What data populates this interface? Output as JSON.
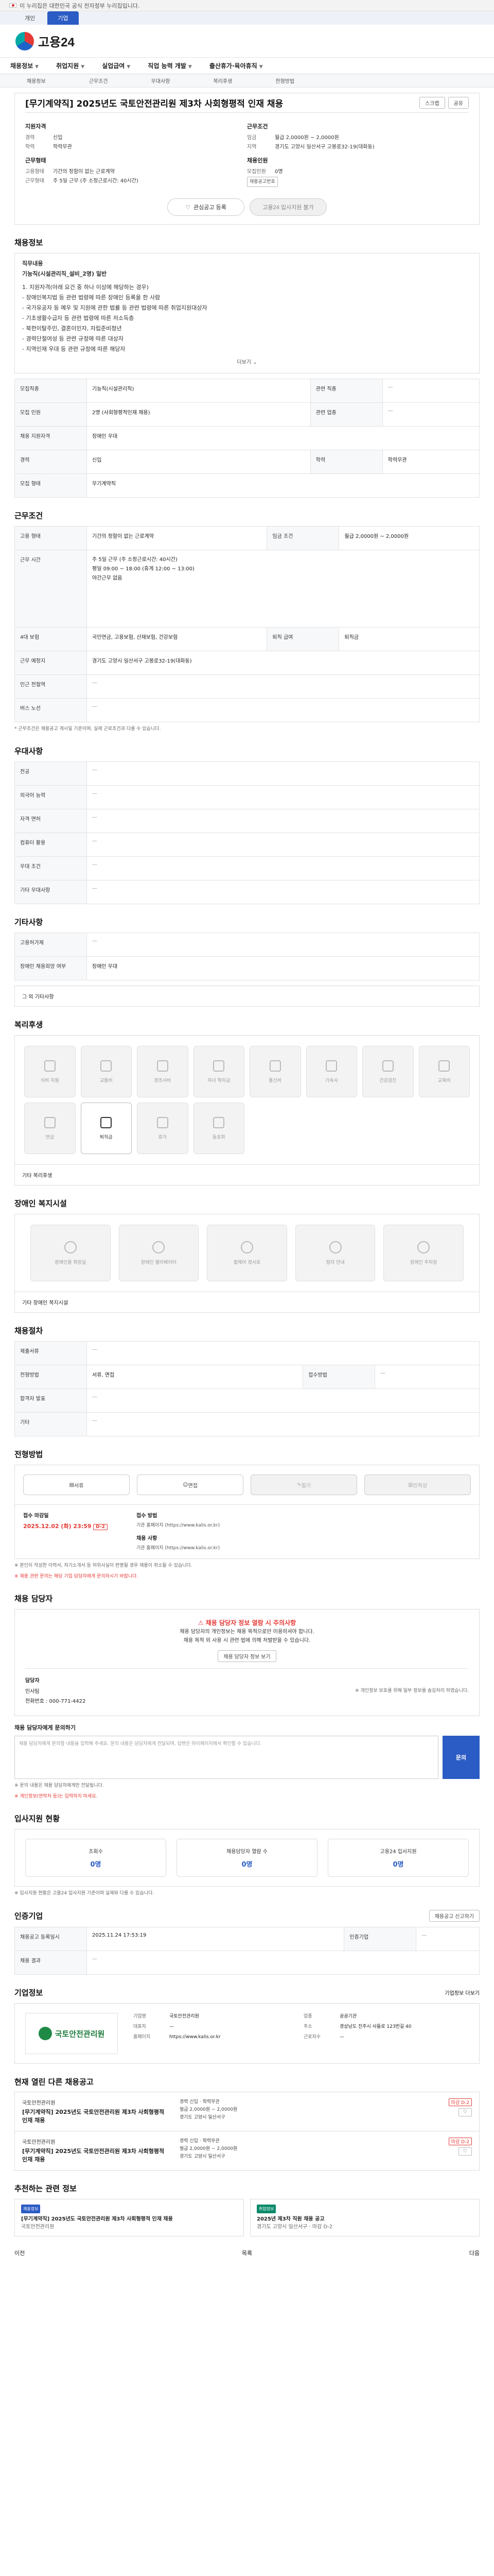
{
  "gov_banner": "이 누리집은 대한민국 공식 전자정부 누리집입니다.",
  "top_tabs": [
    "개인",
    "기업"
  ],
  "logo": "고용24",
  "gnb": [
    "채용정보",
    "취업지원",
    "실업급여",
    "직업 능력 개발",
    "출산휴가·육아휴직"
  ],
  "snb": [
    "채용정보",
    "근무조건",
    "우대사항",
    "복리후생",
    "전형방법"
  ],
  "title": {
    "prefix": "[무기계약직]",
    "text": "[무기계약직] 2025년도 국토안전관리원 제3차 사회형평적 인재 채용",
    "scrap": "스크랩",
    "share": "공유"
  },
  "summary": {
    "col1": {
      "head": "지원자격",
      "rows": [
        {
          "k": "경력",
          "v": "신입"
        },
        {
          "k": "학력",
          "v": "학력무관"
        }
      ],
      "head2": "근무형태",
      "rows2": [
        {
          "k": "고용형태",
          "v": "기간의 정함이 없는 근로계약"
        },
        {
          "k": "근무형태",
          "v": "주 5일 근무 (주 소정근로시간: 40시간)"
        }
      ]
    },
    "col2": {
      "head": "근무조건",
      "rows": [
        {
          "k": "임금",
          "v": "월급 2,0000원 ~ 2,0000원"
        },
        {
          "k": "지역",
          "v": "경기도 고양시 일산서구 고봉로32-19(대화동)"
        }
      ],
      "head2": "채용인원",
      "rows2": [
        {
          "k": "모집인원",
          "v": "0명"
        }
      ],
      "tag": "채용공고번호"
    }
  },
  "actions": [
    "관심공고 등록",
    "고용24 입사지원 불가"
  ],
  "sections": {
    "recruit_info": "채용정보",
    "work_cond": "근무조건",
    "prefer": "우대사항",
    "etc_info": "기타사항",
    "welfare": "복리후생",
    "disabled": "장애인 복지시설",
    "hire_process": "채용절차",
    "process": "전형방법",
    "manager": "채용 담당자",
    "stats": "입사지원 현황",
    "institution": "인증기업",
    "company": "기업정보",
    "same_company": "현재 열린 다른 채용공고",
    "related": "추천하는 관련 정보"
  },
  "job_desc": {
    "label": "직무내용",
    "big": "기능직(시설관리직_설비_2명) 일반",
    "lines": [
      "1. 지원자격(아래 요건 중 하나 이상에 해당하는 경우)",
      " - 장애인복지법 등 관련 법령에 따른 장애인 등록을 한 사람",
      " - 국가유공자 등 예우 및 지원에 관한 법률 등 관련 법령에 따른 취업지원대상자",
      " - 기초생활수급자 등 관련 법령에 따른 저소득층",
      " - 북한이탈주민, 결혼이민자, 자립준비청년",
      " - 경력단절여성 등 관련 규정에 따른 대상자",
      " - 지역인재 우대 등 관련 규정에 따른 해당자"
    ],
    "more": "더보기"
  },
  "recruit_table": [
    {
      "k": "모집직종",
      "v": "기능직(시설관리직)",
      "k2": "관련 직종",
      "v2": "—"
    },
    {
      "k": "모집 인원",
      "v": "2명 (사회형평적인재 채용)",
      "k2": "관련 업종",
      "v2": "—"
    },
    {
      "k": "채용 지원자격",
      "v": "장애인 우대",
      "k2": "",
      "v2": ""
    },
    {
      "k": "경력",
      "v": "신입",
      "k2": "학력",
      "v2": "학력무관"
    },
    {
      "k": "모집 형태",
      "v": "무기계약직",
      "k2": "",
      "v2": ""
    }
  ],
  "work_table": [
    {
      "k": "고용 형태",
      "v": "기간의 정함이 없는 근로계약",
      "k2": "임금 조건",
      "v2": "월급 2,0000원 ~ 2,0000원"
    },
    {
      "k": "근무 시간",
      "v": "주 5일 근무 (주 소정근로시간: 40시간)\n평일 09:00 ~ 18:00 (휴게 12:00 ~ 13:00)\n야간근무 없음",
      "k2": "",
      "v2": ""
    },
    {
      "k": "4대 보험",
      "v": "국민연금, 고용보험, 산재보험, 건강보험",
      "k2": "퇴직 급여",
      "v2": "퇴직금"
    },
    {
      "k": "근무 예정지",
      "v": "경기도 고양시 일산서구 고봉로32-19(대화동)",
      "k2": "",
      "v2": ""
    },
    {
      "k": "인근 전철역",
      "v": "—",
      "k2": "",
      "v2": ""
    },
    {
      "k": "버스 노선",
      "v": "—",
      "k2": "",
      "v2": ""
    }
  ],
  "work_note": "* 근무조건은 채용공고 게시일 기준이며, 실제 근로조건과 다를 수 있습니다.",
  "prefer_table": [
    {
      "k": "전공",
      "v": "—"
    },
    {
      "k": "외국어 능력",
      "v": "—"
    },
    {
      "k": "자격 면허",
      "v": "—"
    },
    {
      "k": "컴퓨터 활용",
      "v": "—"
    },
    {
      "k": "우대 조건",
      "v": "—"
    },
    {
      "k": "기타 우대사항",
      "v": "—"
    }
  ],
  "etc_table": [
    {
      "k": "고용허가제",
      "v": "—"
    },
    {
      "k": "장애인 채용희망 여부",
      "v": "장애인 우대"
    }
  ],
  "etc_note": "그 외 기타사항",
  "welfare_items": [
    "식비 지원",
    "교통비",
    "경조사비",
    "자녀 학자금",
    "통신비",
    "기숙사",
    "건강검진",
    "교육비",
    "연금",
    "퇴직금",
    "휴가",
    "동호회"
  ],
  "welfare_sub": "기타 복리후생",
  "disabled_items": [
    "장애인용 화장실",
    "장애인 엘리베이터",
    "휠체어 경사로",
    "점자 안내",
    "장애인 주차장"
  ],
  "disabled_sub": "기타 장애인 복지시설",
  "process_table": [
    {
      "k": "제출서류",
      "v": "—"
    },
    {
      "k": "전형방법",
      "v": "서류, 면접",
      "k2": "접수방법",
      "v2": "—"
    },
    {
      "k": "합격자 발표",
      "v": "—",
      "k2": "",
      "v2": ""
    },
    {
      "k": "기타",
      "v": "—",
      "k2": "",
      "v2": ""
    }
  ],
  "process_buttons": [
    "서류",
    "면접",
    "필기",
    "인적성"
  ],
  "deadline": {
    "label": "접수 마감일",
    "date": "2025.12.02 (화) 23:59",
    "remain": "D-2",
    "label2": "접수 방법",
    "method": "기관 홈페이지 (https://www.kalis.or.kr)",
    "contact_label": "채용 사항",
    "contact": "기관 홈페이지 (https://www.kalis.or.kr)"
  },
  "hire_notes": [
    "※ 본인이 작성한 이력서, 자기소개서 등 허위사실이 판명될 경우 채용이 취소될 수 있습니다.",
    "※ 채용 관련 문의는 해당 기업 담당자에게 문의하시기 바랍니다."
  ],
  "manager": {
    "notice_title": "채용 담당자 정보 열람 시 주의사항",
    "notice_lines": [
      "채용 담당자의 개인정보는 채용 목적으로만 이용하셔야 합니다.",
      "채용 목적 외 사용 시 관련 법에 의해 처벌받을 수 있습니다."
    ],
    "view_btn": "채용 담당자 정보 보기",
    "name_label": "담당자",
    "name": "인사팀",
    "phone": "전화번호 : 000-771-4422",
    "mask_note": "※ 개인정보 보호를 위해 일부 정보를 숨김처리 하였습니다.",
    "ask_label": "채용 담당자에게 문의하기",
    "ask_placeholder": "채용 담당자에게 문의할 내용을 입력해 주세요. 문의 내용은 담당자에게 전달되며, 답변은 마이페이지에서 확인할 수 있습니다.",
    "ask_btn": "문의",
    "ask_notes": [
      "※ 문의 내용은 채용 담당자에게만 전달됩니다.",
      "※ 개인정보(연락처 등)는 입력하지 마세요."
    ]
  },
  "stats": [
    {
      "t": "조회수",
      "n": "0명"
    },
    {
      "t": "채용담당자 열람 수",
      "n": "0명"
    },
    {
      "t": "고용24 입사지원",
      "n": "0명"
    }
  ],
  "stats_note": "※ 입사지원 현황은 고용24 입사지원 기준이며 실제와 다를 수 있습니다.",
  "cert_table": [
    {
      "k": "채용공고 등록일시",
      "v": "2025.11.24 17:53:19",
      "k2": "인증기업",
      "v2": "—"
    },
    {
      "k": "채용 결과",
      "v": "—",
      "k2": "",
      "v2": ""
    }
  ],
  "cert_btn": "채용공고 신고하기",
  "company": {
    "name": "국토안전관리원",
    "info": [
      {
        "k": "기업명",
        "v": "국토안전관리원"
      },
      {
        "k": "업종",
        "v": "공공기관"
      },
      {
        "k": "대표자",
        "v": "—"
      },
      {
        "k": "주소",
        "v": "경상남도 진주시 사들로 123번길 40"
      },
      {
        "k": "홈페이지",
        "v": "https://www.kalis.or.kr"
      },
      {
        "k": "근로자수",
        "v": "—"
      }
    ],
    "link": "기업정보 더보기"
  },
  "other_jobs": [
    {
      "comp": "국토안전관리원",
      "title": "[무기계약직] 2025년도 국토안전관리원 제3차 사회형평적 인재 채용",
      "info": "경력 신입 · 학력무관\n월급 2,0000원 ~ 2,0000원\n경기도 고양시 일산서구",
      "deadline": "마감 D-2"
    },
    {
      "comp": "국토안전관리원",
      "title": "[무기계약직] 2025년도 국토안전관리원 제3차 사회형평적 인재 채용",
      "info": "경력 신입 · 학력무관\n월급 2,0000원 ~ 2,0000원\n경기도 고양시 일산서구",
      "deadline": "마감 D-2"
    }
  ],
  "related": [
    {
      "badge": "채용정보",
      "title": "[무기계약직] 2025년도 국토안전관리원 제3차 사회형평적 인재 채용",
      "sub": "국토안전관리원"
    },
    {
      "badge": "취업정보",
      "title": "2025년 제3차 직원 채용 공고",
      "sub": "경기도 고양시 일산서구 · 마감 D-2"
    }
  ],
  "bottom_nav": {
    "prev": "이전",
    "list": "목록",
    "next": "다음"
  }
}
